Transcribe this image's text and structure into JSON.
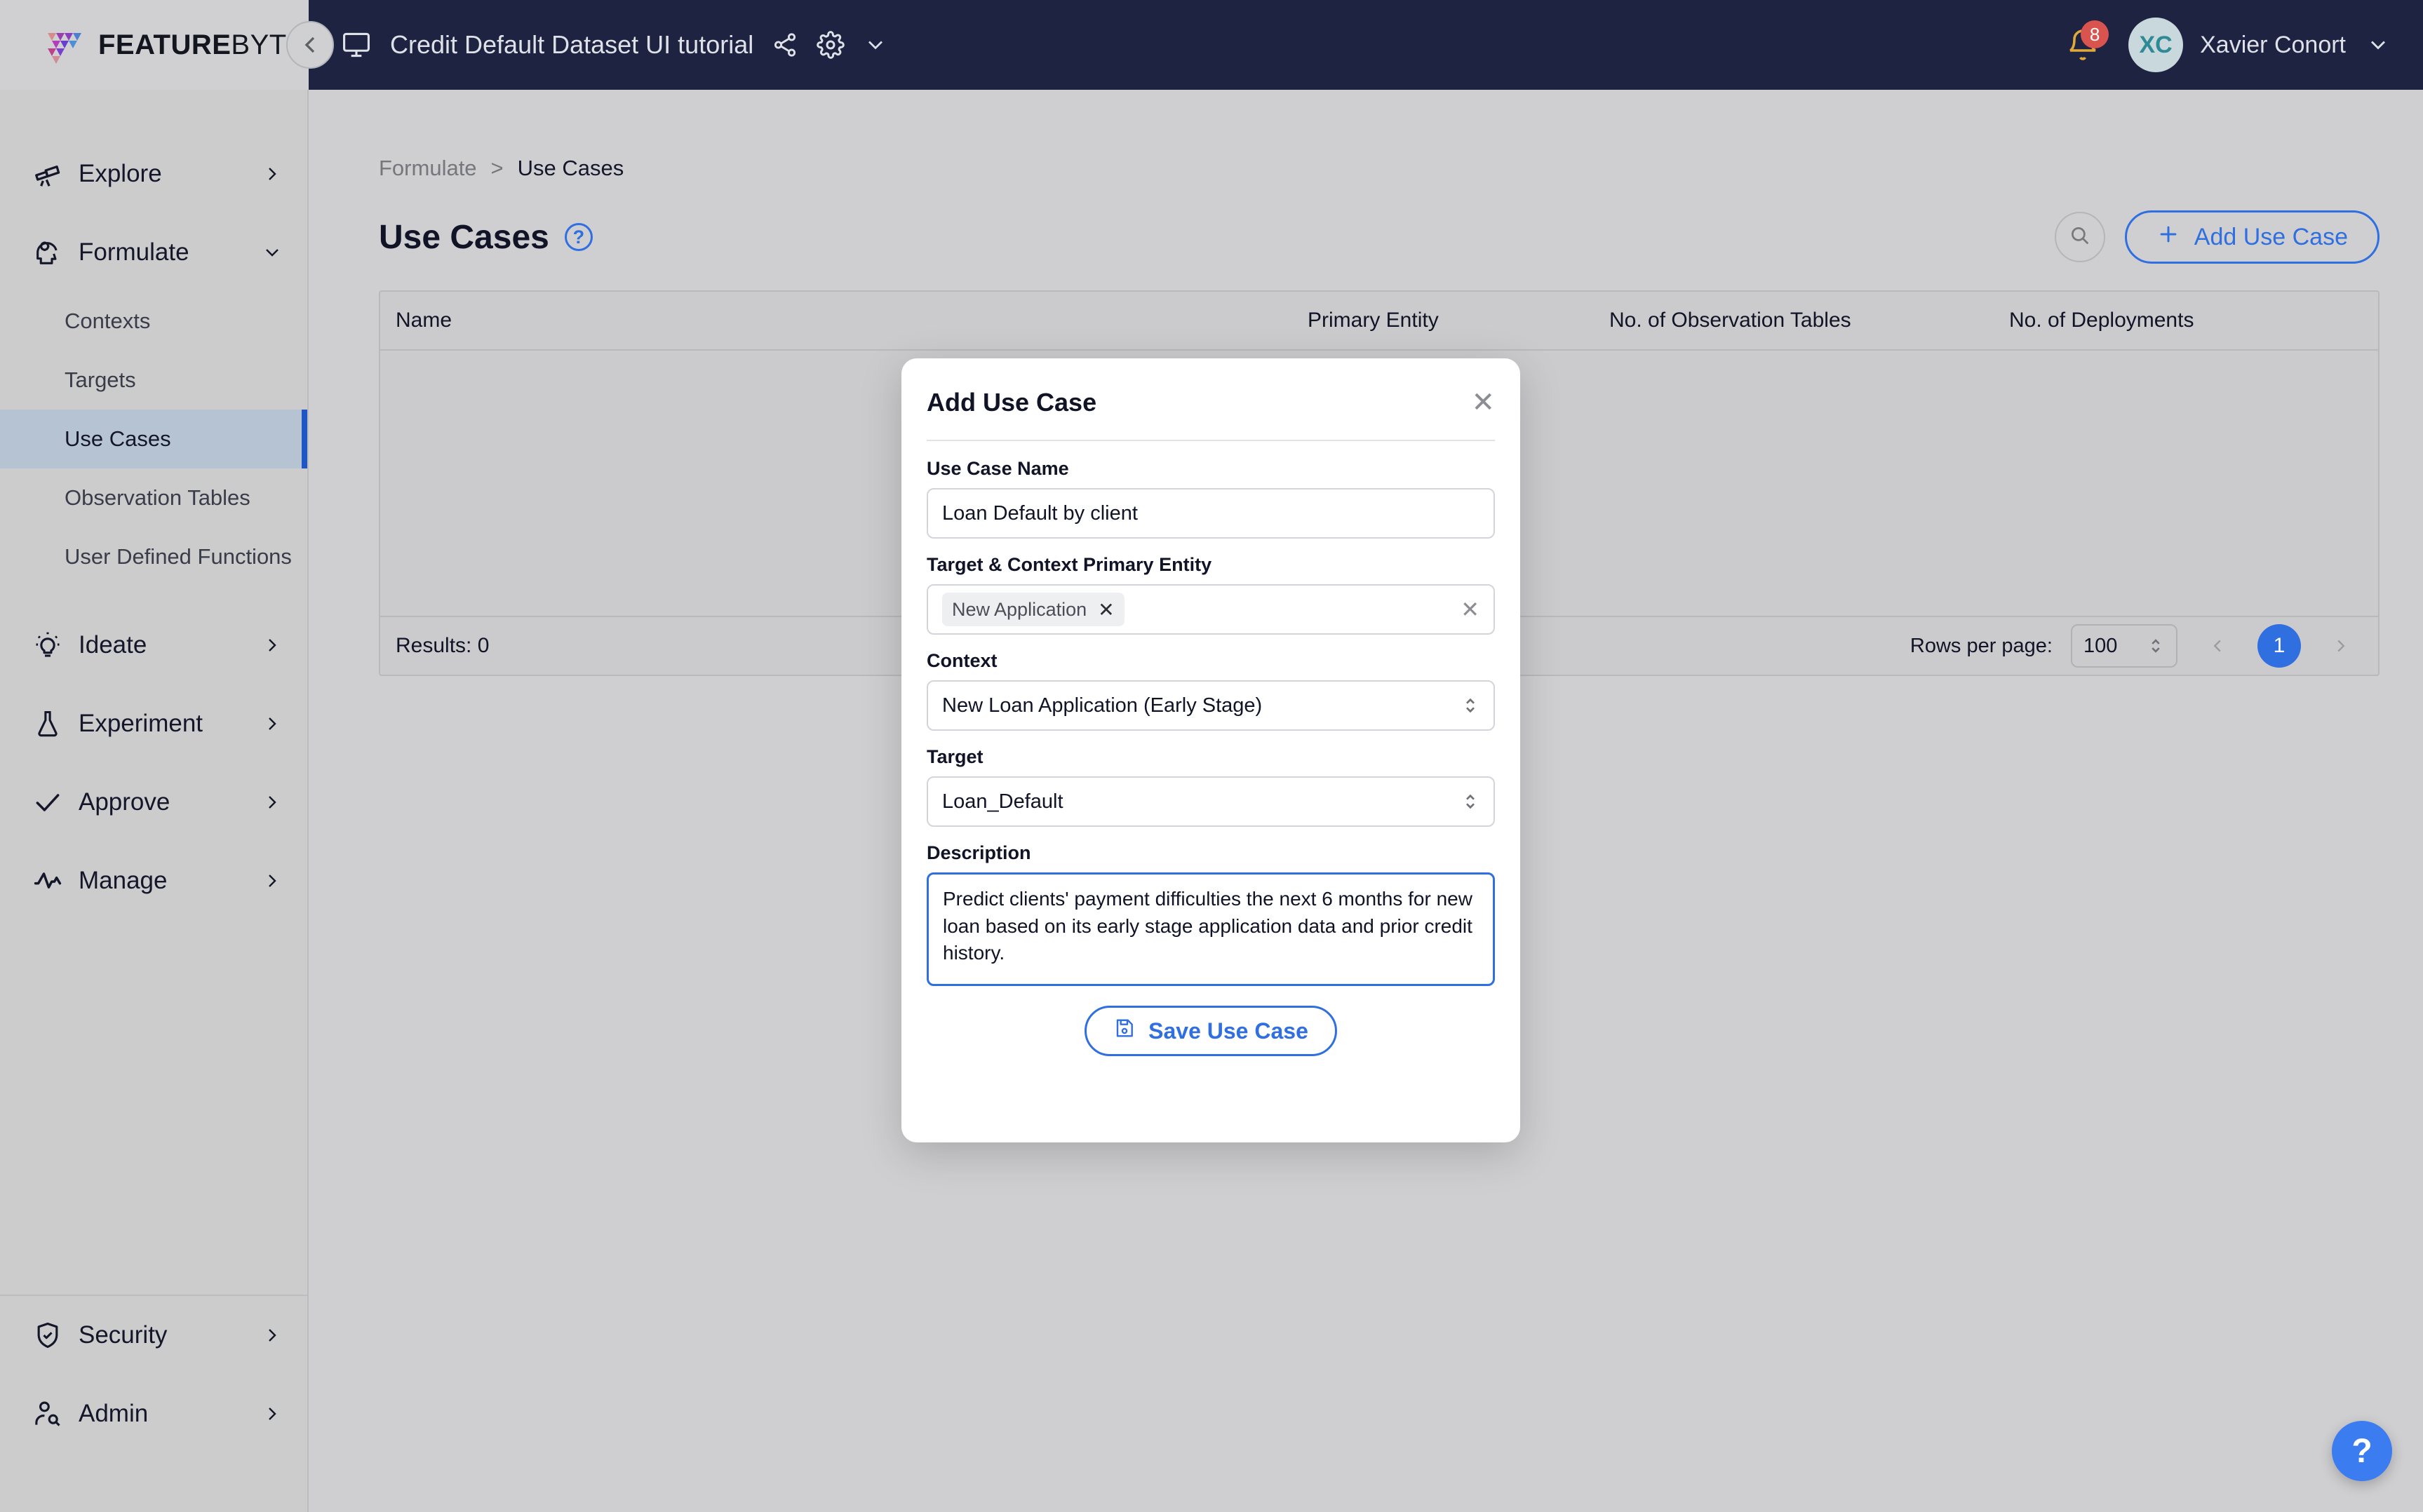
{
  "brand": {
    "name_bold": "FEATURE",
    "name_light": "BYTE"
  },
  "topbar": {
    "collapse_icon": "chevron-left-icon",
    "monitor_icon": "monitor-icon",
    "doc_title": "Credit Default Dataset UI tutorial",
    "share_icon": "share-icon",
    "settings_icon": "gear-icon",
    "caret_icon": "chevron-down-icon",
    "bell_icon": "bell-icon",
    "notification_count": "8",
    "avatar_initials": "XC",
    "user_name": "Xavier Conort",
    "user_caret_icon": "chevron-down-icon",
    "accent": "#1d2340"
  },
  "sidebar": {
    "groups": [
      {
        "label": "Explore",
        "icon": "telescope-icon",
        "caret": "chevron-right-icon",
        "expanded": false
      },
      {
        "label": "Formulate",
        "icon": "brain-gear-icon",
        "caret": "chevron-down-icon",
        "expanded": true
      }
    ],
    "formulate_children": [
      {
        "label": "Contexts",
        "active": false
      },
      {
        "label": "Targets",
        "active": false
      },
      {
        "label": "Use Cases",
        "active": true
      },
      {
        "label": "Observation Tables",
        "active": false
      },
      {
        "label": "User Defined Functions",
        "active": false
      }
    ],
    "groups2": [
      {
        "label": "Ideate",
        "icon": "lightbulb-icon",
        "caret": "chevron-right-icon"
      },
      {
        "label": "Experiment",
        "icon": "flask-icon",
        "caret": "chevron-right-icon"
      },
      {
        "label": "Approve",
        "icon": "check-icon",
        "caret": "chevron-right-icon"
      },
      {
        "label": "Manage",
        "icon": "activity-icon",
        "caret": "chevron-right-icon"
      }
    ],
    "groups_bottom": [
      {
        "label": "Security",
        "icon": "shield-check-icon",
        "caret": "chevron-right-icon"
      },
      {
        "label": "Admin",
        "icon": "user-search-icon",
        "caret": "chevron-right-icon"
      }
    ],
    "active_accent": "#1f55c4"
  },
  "breadcrumb": {
    "parent": "Formulate",
    "separator": ">",
    "current": "Use Cases"
  },
  "page": {
    "title": "Use Cases",
    "help_icon": "question-mark-icon",
    "search_icon": "search-icon",
    "add_button_label": "Add Use Case",
    "add_button_icon": "plus-icon",
    "accent_blue": "#2f6fe0"
  },
  "table": {
    "columns": [
      "Name",
      "Primary Entity",
      "No. of Observation Tables",
      "No. of Deployments"
    ],
    "rows": [],
    "results_label": "Results: 0",
    "rows_per_page_label": "Rows per page:",
    "rows_per_page_value": "100",
    "stepper_icon": "chevron-updown-icon",
    "prev_icon": "chevron-left-icon",
    "next_icon": "chevron-right-icon",
    "current_page": "1"
  },
  "modal": {
    "title": "Add Use Case",
    "close_icon": "close-icon",
    "fields": {
      "use_case_name": {
        "label": "Use Case Name",
        "value": "Loan Default by client",
        "placeholder": "Use Case Name"
      },
      "primary_entity": {
        "label": "Target & Context Primary Entity",
        "chip": "New Application",
        "chip_remove_icon": "close-icon",
        "clear_icon": "close-icon"
      },
      "context": {
        "label": "Context",
        "value": "New Loan Application (Early Stage)",
        "caret_icon": "chevron-updown-icon"
      },
      "target": {
        "label": "Target",
        "value": "Loan_Default",
        "caret_icon": "chevron-updown-icon"
      },
      "description": {
        "label": "Description",
        "value": "Predict clients' payment difficulties the next 6 months for new loan based on its early stage application data and prior credit history.",
        "focused": true
      }
    },
    "save_label": "Save Use Case",
    "save_icon": "floppy-disk-icon"
  },
  "fab": {
    "label": "?",
    "icon": "question-mark-icon",
    "color": "#3b7cf0"
  }
}
